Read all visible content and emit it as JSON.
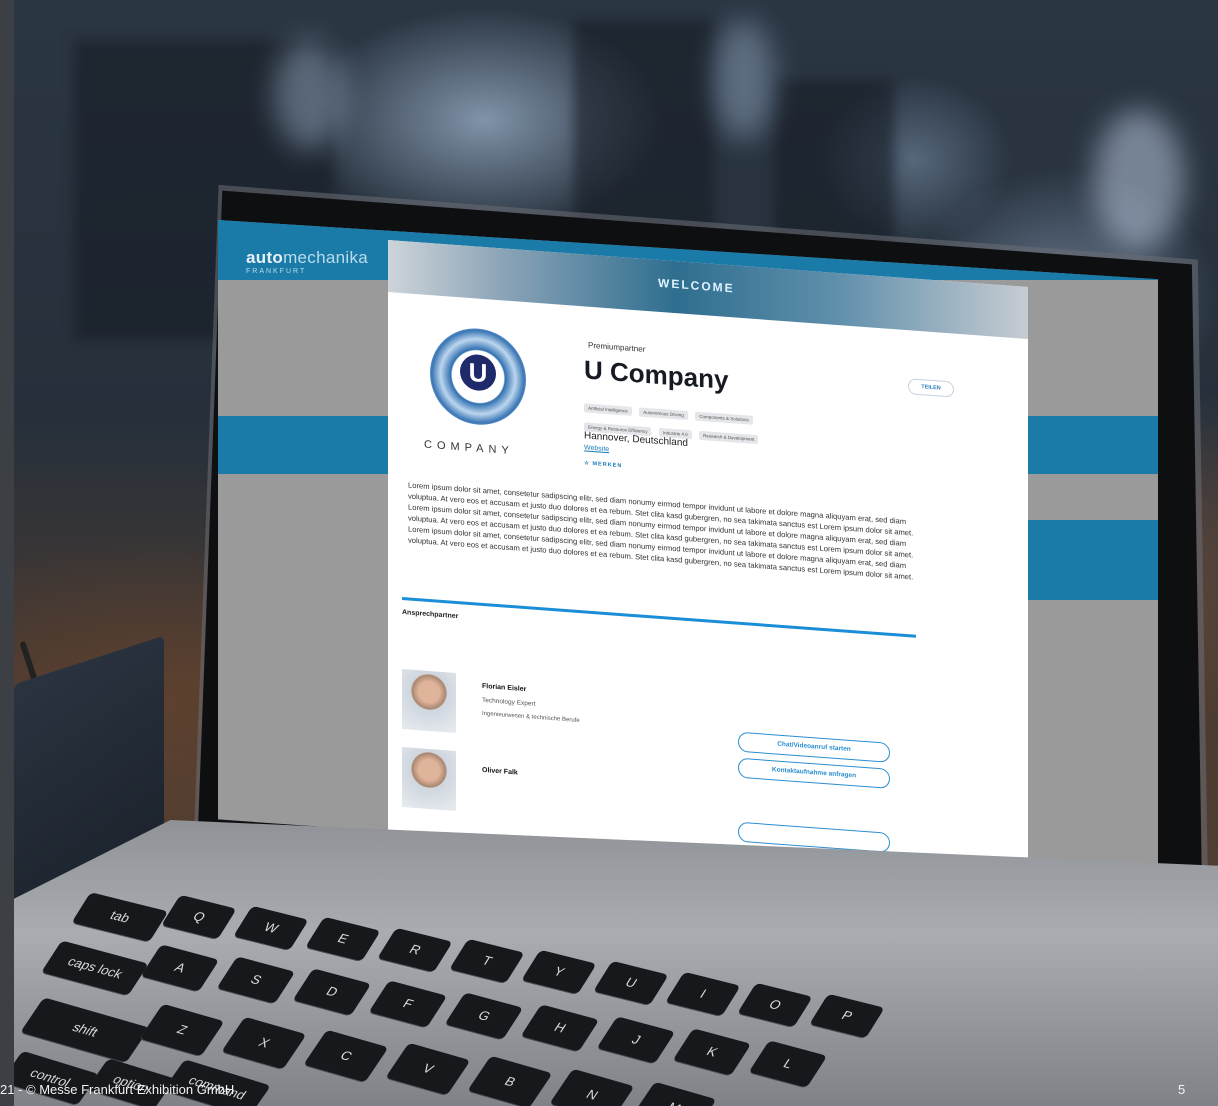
{
  "footer": {
    "copyright": "21 - © Messe Frankfurt Exhibition GmbH",
    "page_number": "5"
  },
  "screen": {
    "brand": {
      "name_bold": "auto",
      "name_light": "mechanika",
      "city": "FRANKFURT"
    },
    "banner_text": "WELCOME",
    "logo": {
      "letter": "U",
      "word": "COMPANY"
    },
    "kicker": "Premiumpartner",
    "company_name": "U Company",
    "share_button": "TEILEN",
    "tags": [
      "Artificial Intelligence",
      "Autonomous Driving",
      "Components & Solutions",
      "Energy & Resource Efficiency",
      "Industrie 4.0",
      "Research & Development"
    ],
    "city": "Hannover, Deutschland",
    "website": "Website",
    "merken": "MERKEN",
    "description": "Lorem ipsum dolor sit amet, consetetur sadipscing elitr, sed diam nonumy eirmod tempor invidunt ut labore et dolore magna aliquyam erat, sed diam voluptua. At vero eos et accusam et justo duo dolores et ea rebum. Stet clita kasd gubergren, no sea takimata sanctus est Lorem ipsum dolor sit amet. Lorem ipsum dolor sit amet, consetetur sadipscing elitr, sed diam nonumy eirmod tempor invidunt ut labore et dolore magna aliquyam erat, sed diam voluptua. At vero eos et accusam et justo duo dolores et ea rebum. Stet clita kasd gubergren, no sea takimata sanctus est Lorem ipsum dolor sit amet. Lorem ipsum dolor sit amet, consetetur sadipscing elitr, sed diam nonumy eirmod tempor invidunt ut labore et dolore magna aliquyam erat, sed diam voluptua. At vero eos et accusam et justo duo dolores et ea rebum. Stet clita kasd gubergren, no sea takimata sanctus est Lorem ipsum dolor sit amet.",
    "contacts_heading": "Ansprechpartner",
    "contacts": [
      {
        "name": "Florian Eisler",
        "role": "Technology Expert",
        "department": "Ingenieurwesen & technische Berufe"
      },
      {
        "name": "Oliver Falk",
        "role": "",
        "department": ""
      }
    ],
    "buttons": {
      "chat": "Chat/Videoanruf starten",
      "contact": "Kontaktaufnahme anfragen"
    }
  },
  "keyboard": {
    "keys": [
      "tab",
      "caps lock",
      "shift",
      "control",
      "option",
      "command",
      "Q",
      "W",
      "E",
      "R",
      "T",
      "Y",
      "U",
      "I",
      "O",
      "P",
      "A",
      "S",
      "D",
      "F",
      "G",
      "H",
      "J",
      "K",
      "L",
      "Z",
      "X",
      "C",
      "V",
      "B",
      "N",
      "M"
    ]
  }
}
